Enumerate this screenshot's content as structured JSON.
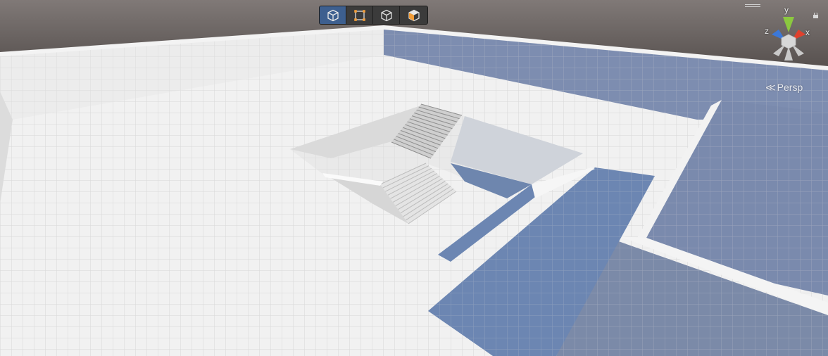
{
  "app": {
    "view": "Scene"
  },
  "toolbar": {
    "tools": [
      {
        "name": "view-3d-tool",
        "icon": "wireframe-cube-icon",
        "active": true
      },
      {
        "name": "rect-tool",
        "icon": "rect-transform-icon",
        "active": false
      },
      {
        "name": "cube-tool",
        "icon": "cube-outline-icon",
        "active": false
      },
      {
        "name": "render-mode-tool",
        "icon": "half-shaded-cube-icon",
        "active": false
      }
    ]
  },
  "gizmo": {
    "x_label": "x",
    "y_label": "y",
    "z_label": "z",
    "colors": {
      "x": "#e0412d",
      "y": "#8bc83f",
      "z": "#3c78d8",
      "center": "#d7d7d7"
    }
  },
  "projection": {
    "label": "Persp",
    "icon": "chevron-left-icon"
  },
  "colors": {
    "sky": "#5a5553",
    "floor": "#f0f0f0",
    "grid": "#cdcdcd",
    "shadow": "#7488a8",
    "wall": "#e6e6e6",
    "active_tool": "#3d5f8f",
    "accent": "#f29d38"
  }
}
